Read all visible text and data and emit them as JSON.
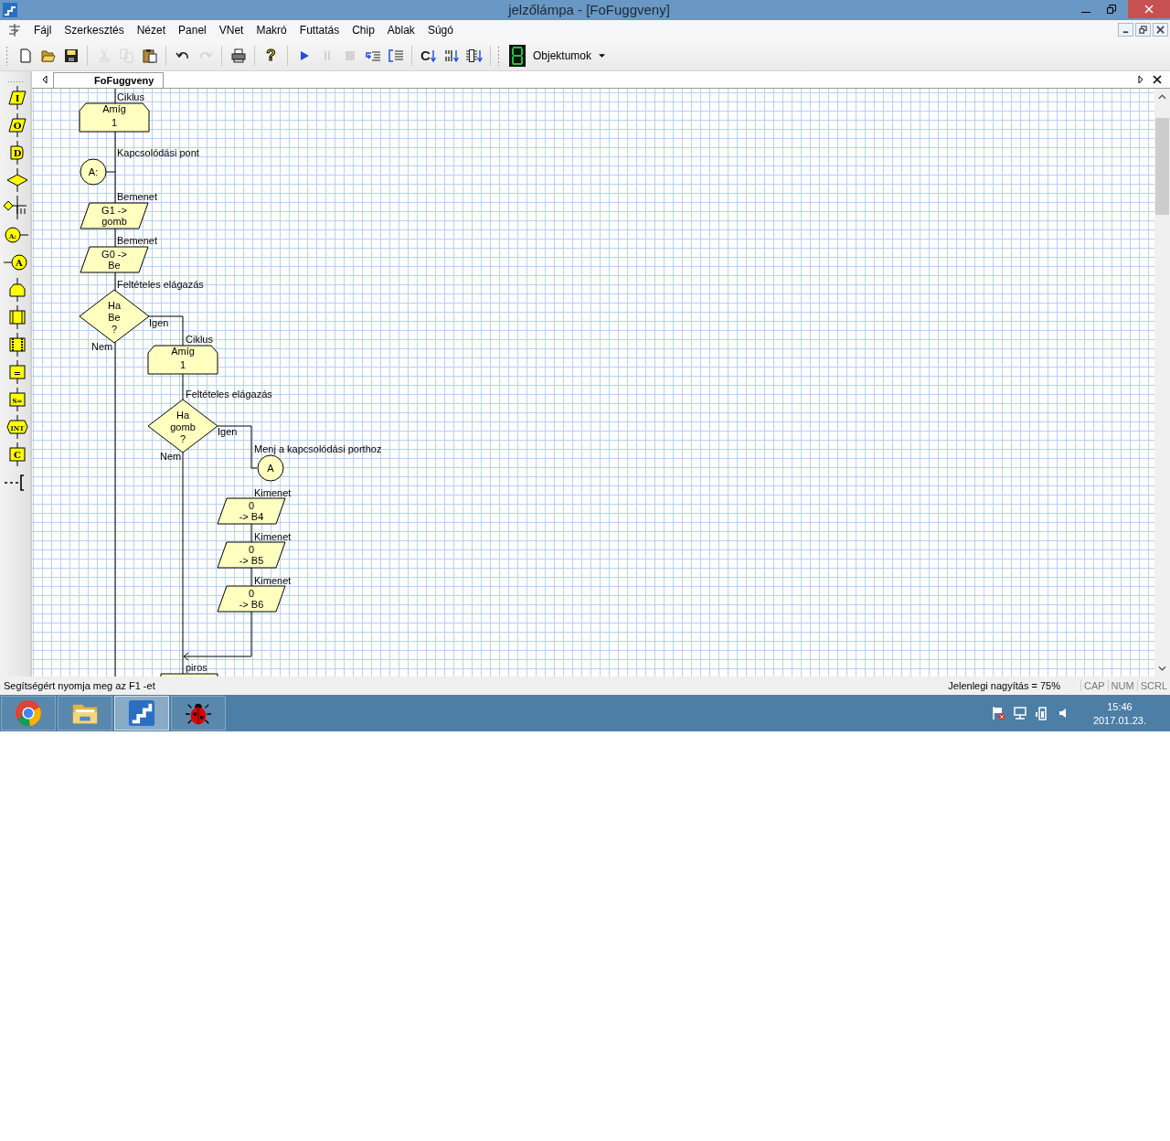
{
  "window": {
    "title": "jelzőlámpa - [FoFuggveny]"
  },
  "menu": [
    "Fájl",
    "Szerkesztés",
    "Nézet",
    "Panel",
    "VNet",
    "Makró",
    "Futtatás",
    "Chip",
    "Ablak",
    "Súgó"
  ],
  "toolbar": [
    {
      "kind": "new",
      "disabled": false
    },
    {
      "kind": "open",
      "disabled": false
    },
    {
      "kind": "save",
      "disabled": false
    },
    {
      "kind": "separator"
    },
    {
      "kind": "cut",
      "disabled": true
    },
    {
      "kind": "copy",
      "disabled": true
    },
    {
      "kind": "paste",
      "disabled": false
    },
    {
      "kind": "separator"
    },
    {
      "kind": "undo",
      "disabled": false
    },
    {
      "kind": "redo",
      "disabled": true
    },
    {
      "kind": "separator"
    },
    {
      "kind": "print",
      "disabled": false
    },
    {
      "kind": "separator"
    },
    {
      "kind": "help",
      "glyph": "?",
      "disabled": false
    },
    {
      "kind": "separator"
    },
    {
      "kind": "run",
      "disabled": false
    },
    {
      "kind": "pause",
      "disabled": true
    },
    {
      "kind": "stop",
      "disabled": true
    },
    {
      "kind": "step-into",
      "disabled": false
    },
    {
      "kind": "step-over",
      "disabled": false
    },
    {
      "kind": "separator"
    },
    {
      "kind": "code-down",
      "glyph": "C",
      "disabled": false
    },
    {
      "kind": "bits-down",
      "disabled": false
    },
    {
      "kind": "chip-down",
      "disabled": false
    }
  ],
  "objects_dropdown": {
    "label": "Objektumok"
  },
  "tabs": [
    {
      "label": "FoFuggveny",
      "selected": true
    }
  ],
  "palette": [
    {
      "kind": "input",
      "glyph": "I"
    },
    {
      "kind": "output",
      "glyph": "O"
    },
    {
      "kind": "delay",
      "glyph": "D"
    },
    {
      "kind": "decision"
    },
    {
      "kind": "switch"
    },
    {
      "kind": "connector",
      "glyph": "A:"
    },
    {
      "kind": "goto",
      "glyph": "A"
    },
    {
      "kind": "loop"
    },
    {
      "kind": "macro"
    },
    {
      "kind": "component"
    },
    {
      "kind": "calculation",
      "glyph": "="
    },
    {
      "kind": "string",
      "glyph": "S="
    },
    {
      "kind": "interrupt",
      "glyph": "INT"
    },
    {
      "kind": "code",
      "glyph": "C"
    },
    {
      "kind": "comment"
    }
  ],
  "flowchart": {
    "nodes": [
      {
        "kind": "loop",
        "label": "Ciklus",
        "lines": [
          "Amíg",
          "1"
        ]
      },
      {
        "kind": "connector",
        "label": "Kapcsolódási pont",
        "lines": [
          "A:"
        ]
      },
      {
        "kind": "input",
        "label": "Bemenet",
        "lines": [
          "G1 ->",
          "gomb"
        ]
      },
      {
        "kind": "input",
        "label": "Bemenet",
        "lines": [
          "G0 ->",
          "Be"
        ]
      },
      {
        "kind": "decision",
        "label": "Feltételes elágazás",
        "lines": [
          "Ha",
          "Be",
          "?"
        ],
        "yes": "Igen",
        "no": "Nem"
      },
      {
        "kind": "loop",
        "label": "Ciklus",
        "lines": [
          "Amíg",
          "1"
        ]
      },
      {
        "kind": "decision",
        "label": "Feltételes elágazás",
        "lines": [
          "Ha",
          "gomb",
          "?"
        ],
        "yes": "Igen",
        "no": "Nem"
      },
      {
        "kind": "goto",
        "label": "Menj a kapcsolódási porthoz",
        "lines": [
          "A"
        ]
      },
      {
        "kind": "output",
        "label": "Kimenet",
        "lines": [
          "0",
          "-> B4"
        ]
      },
      {
        "kind": "output",
        "label": "Kimenet",
        "lines": [
          "0",
          "-> B5"
        ]
      },
      {
        "kind": "output",
        "label": "Kimenet",
        "lines": [
          "0",
          "-> B6"
        ]
      },
      {
        "kind": "cut",
        "label": "piros"
      }
    ]
  },
  "status_bar": {
    "hint": "Segítségért nyomja meg az F1 -et",
    "zoom": "Jelenlegi nagyítás = 75%",
    "indicators": [
      "CAP",
      "NUM",
      "SCRL"
    ]
  },
  "taskbar": {
    "apps": [
      {
        "kind": "browser",
        "selected": false
      },
      {
        "kind": "folder",
        "selected": false
      },
      {
        "kind": "flowchart-app",
        "selected": true
      },
      {
        "kind": "bug",
        "selected": false
      }
    ],
    "time": "15:46",
    "date": "2017.01.23."
  }
}
